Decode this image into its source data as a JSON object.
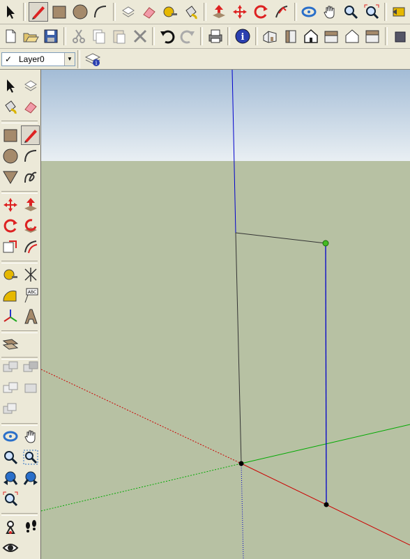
{
  "toolbar_top": {
    "row1": [
      "select-tool",
      "line-tool",
      "rectangle-tool",
      "circle-tool",
      "arc-tool",
      "make-component-tool",
      "eraser-tool",
      "tape-measure-tool",
      "paint-bucket-tool",
      "push-pull-tool",
      "move-tool",
      "rotate-tool",
      "follow-me-tool",
      "orbit-tool",
      "pan-tool",
      "zoom-tool",
      "zoom-extents-tool",
      "previous-view-tool"
    ],
    "row2": [
      "new-file",
      "open-file",
      "save-file",
      "cut",
      "copy",
      "paste",
      "delete",
      "undo",
      "redo",
      "print",
      "model-info",
      "iso-view",
      "front-view",
      "top-view",
      "back-view",
      "right-view",
      "left-view",
      "next-tool"
    ]
  },
  "layers": {
    "current_layer": "Layer0",
    "check_mark": "✓"
  },
  "sidebar": {
    "groups": [
      [
        "select",
        "make-component"
      ],
      [
        "paint-bucket",
        "eraser"
      ],
      [
        "rectangle",
        "line"
      ],
      [
        "circle",
        "arc"
      ],
      [
        "polygon",
        "freehand"
      ],
      [
        "move",
        "push-pull"
      ],
      [
        "rotate",
        "follow-me"
      ],
      [
        "scale",
        "offset"
      ],
      [
        "tape-measure",
        "dimension"
      ],
      [
        "protractor",
        "text"
      ],
      [
        "axes",
        "3d-text"
      ],
      [
        "section-plane"
      ],
      [
        "union",
        "subtract"
      ],
      [
        "intersect",
        "trim"
      ],
      [
        "split"
      ],
      [
        "orbit",
        "pan"
      ],
      [
        "zoom",
        "zoom-window"
      ],
      [
        "previous",
        "next"
      ],
      [
        "zoom-extents"
      ],
      [
        "position-camera",
        "walk"
      ],
      [
        "look-around"
      ]
    ]
  },
  "colors": {
    "sky_top": "#a3bcd6",
    "sky_bottom": "#e9eff3",
    "ground": "#b7c1a3",
    "axis_red": "#cc0000",
    "axis_green": "#00aa00",
    "axis_blue": "#0000cc",
    "edge": "#333333",
    "endpoint": "#000000",
    "inference_point": "#44bb22"
  }
}
